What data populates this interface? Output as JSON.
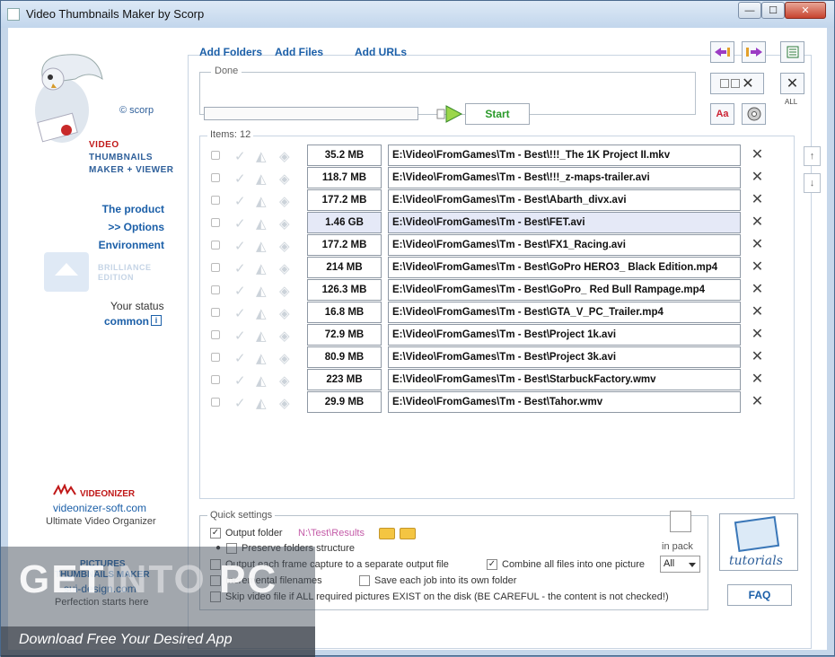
{
  "window": {
    "title": "Video Thumbnails Maker by Scorp",
    "minimize": "—",
    "maximize": "☐",
    "close": "✕"
  },
  "branding": {
    "scorp": "© scorp",
    "line1": "VIDEO",
    "line2": "THUMBNAILS",
    "line3a": "MAKER + ",
    "line3b": "VIEWER",
    "brilliance_line1": "BRILLIANCE",
    "brilliance_line2": "EDITION"
  },
  "left_nav": {
    "product": "The product",
    "options": ">> Options",
    "environment": "Environment",
    "status_label": "Your status",
    "status_value": "common",
    "info": "i"
  },
  "ads": {
    "videonizer_name": "VIDEONIZER",
    "videonizer_site": "videonizer-soft.com",
    "videonizer_desc": "Ultimate Video Organizer",
    "pictures_name": "PICTURES",
    "pictures_sub": "THUMBNAILS MAKER",
    "sui_site": "sui-design.com",
    "sui_desc": "Perfection starts here"
  },
  "toolbar": {
    "add_folders": "Add Folders",
    "add_files": "Add Files",
    "add_urls": "Add URLs",
    "done_label": "Done",
    "start": "Start",
    "all_label": "ALL",
    "font_icon": "Aa"
  },
  "items": {
    "label": "Items: 12",
    "rows": [
      {
        "size": "35.2 MB",
        "path": "E:\\Video\\FromGames\\Tm - Best\\!!!_The 1K Project II.mkv"
      },
      {
        "size": "118.7 MB",
        "path": "E:\\Video\\FromGames\\Tm - Best\\!!!_z-maps-trailer.avi"
      },
      {
        "size": "177.2 MB",
        "path": "E:\\Video\\FromGames\\Tm - Best\\Abarth_divx.avi"
      },
      {
        "size": "1.46 GB",
        "path": "E:\\Video\\FromGames\\Tm - Best\\FET.avi"
      },
      {
        "size": "177.2 MB",
        "path": "E:\\Video\\FromGames\\Tm - Best\\FX1_Racing.avi"
      },
      {
        "size": "214 MB",
        "path": "E:\\Video\\FromGames\\Tm - Best\\GoPro HERO3_ Black Edition.mp4"
      },
      {
        "size": "126.3 MB",
        "path": "E:\\Video\\FromGames\\Tm - Best\\GoPro_ Red Bull Rampage.mp4"
      },
      {
        "size": "16.8 MB",
        "path": "E:\\Video\\FromGames\\Tm - Best\\GTA_V_PC_Trailer.mp4"
      },
      {
        "size": "72.9 MB",
        "path": "E:\\Video\\FromGames\\Tm - Best\\Project 1k.avi"
      },
      {
        "size": "80.9 MB",
        "path": "E:\\Video\\FromGames\\Tm - Best\\Project 3k.avi"
      },
      {
        "size": "223 MB",
        "path": "E:\\Video\\FromGames\\Tm - Best\\StarbuckFactory.wmv"
      },
      {
        "size": "29.9 MB",
        "path": "E:\\Video\\FromGames\\Tm - Best\\Tahor.wmv"
      }
    ],
    "selected_index": 3
  },
  "quick_settings": {
    "label": "Quick settings",
    "output_folder": "Output folder",
    "output_path": "N:\\Test\\Results",
    "preserve": "Preserve folders structure",
    "each_frame": "Output each frame capture to a separate output file",
    "combine": "Combine all files into one picture",
    "incremental": "Incremental filenames",
    "own_folder": "Save each job into its own folder",
    "skip": "Skip video file if ALL required pictures EXIST on the disk (BE CAREFUL - the content is not checked!)",
    "in_pack_label": "in pack",
    "in_pack_value": "All",
    "checkmark": "✓"
  },
  "help": {
    "tutorials": "tutorials",
    "faq": "FAQ"
  },
  "watermark": {
    "logo_a": "GET",
    "logo_b": "INTO",
    "logo_c": " PC",
    "tagline": "Download Free Your Desired App"
  }
}
